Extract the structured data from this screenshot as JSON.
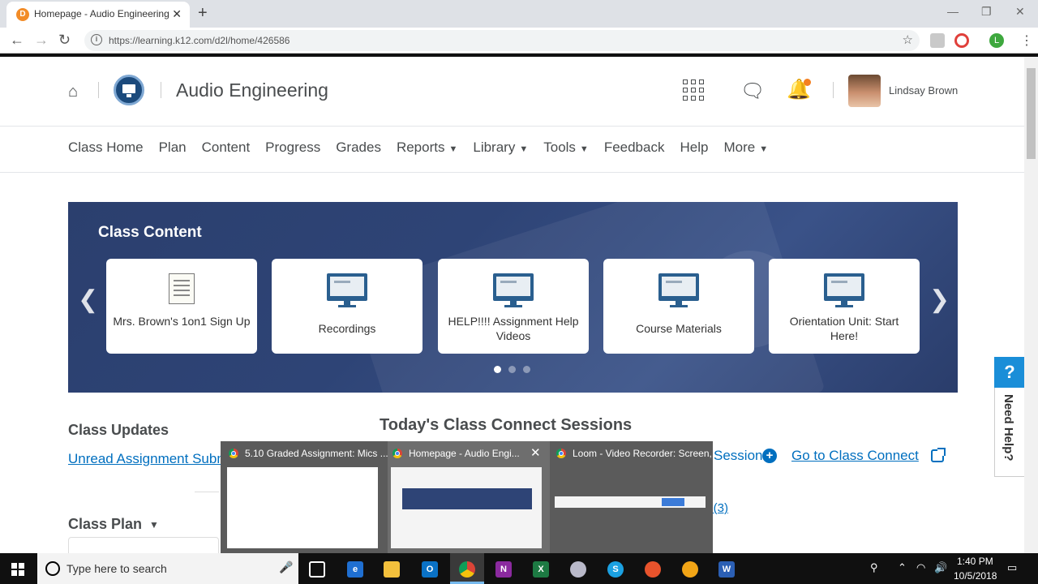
{
  "browser": {
    "tab_title": "Homepage - Audio Engineering",
    "tab_close": "✕",
    "new_tab": "+",
    "url": "https://learning.k12.com/d2l/home/426586",
    "profile_initial": "L"
  },
  "header": {
    "course_title": "Audio Engineering",
    "user_name": "Lindsay Brown"
  },
  "nav": [
    {
      "label": "Class Home",
      "dropdown": false
    },
    {
      "label": "Plan",
      "dropdown": false
    },
    {
      "label": "Content",
      "dropdown": false
    },
    {
      "label": "Progress",
      "dropdown": false
    },
    {
      "label": "Grades",
      "dropdown": false
    },
    {
      "label": "Reports",
      "dropdown": true
    },
    {
      "label": "Library",
      "dropdown": true
    },
    {
      "label": "Tools",
      "dropdown": true
    },
    {
      "label": "Feedback",
      "dropdown": false
    },
    {
      "label": "Help",
      "dropdown": false
    },
    {
      "label": "More",
      "dropdown": true
    }
  ],
  "banner": {
    "title": "Class Content",
    "cards": [
      {
        "label": "Mrs. Brown's 1on1 Sign Up",
        "icon": "document-icon"
      },
      {
        "label": "Recordings",
        "icon": "monitor-icon"
      },
      {
        "label": "HELP!!!! Assignment Help Videos",
        "icon": "monitor-icon"
      },
      {
        "label": "Course Materials",
        "icon": "monitor-icon"
      },
      {
        "label": "Orientation Unit: Start Here!",
        "icon": "monitor-icon"
      }
    ],
    "active_page": 1,
    "page_count": 3
  },
  "widgets": {
    "updates_title": "Class Updates",
    "updates_link": "Unread Assignment Submissions",
    "plan_title": "Class Plan",
    "sessions_title": "Today's Class Connect Sessions",
    "session_link_partial": "Session",
    "connect_link": "Go to Class Connect",
    "partial_text_1": "day",
    "partial_text_2": "s (3)"
  },
  "need_help": {
    "q": "?",
    "label": "Need Help?"
  },
  "taskbar_preview": {
    "windows": [
      {
        "title": "5.10 Graded Assignment: Mics ..."
      },
      {
        "title": "Homepage - Audio Engi..."
      },
      {
        "title": "Loom - Video Recorder: Screen,..."
      }
    ],
    "close": "✕"
  },
  "taskbar": {
    "search_placeholder": "Type here to search",
    "time": "1:40 PM",
    "date": "10/5/2018"
  },
  "colors": {
    "link": "#006fbf",
    "banner": "#2e4476",
    "help_blue": "#1a8ed8",
    "notification": "#f47f20"
  }
}
